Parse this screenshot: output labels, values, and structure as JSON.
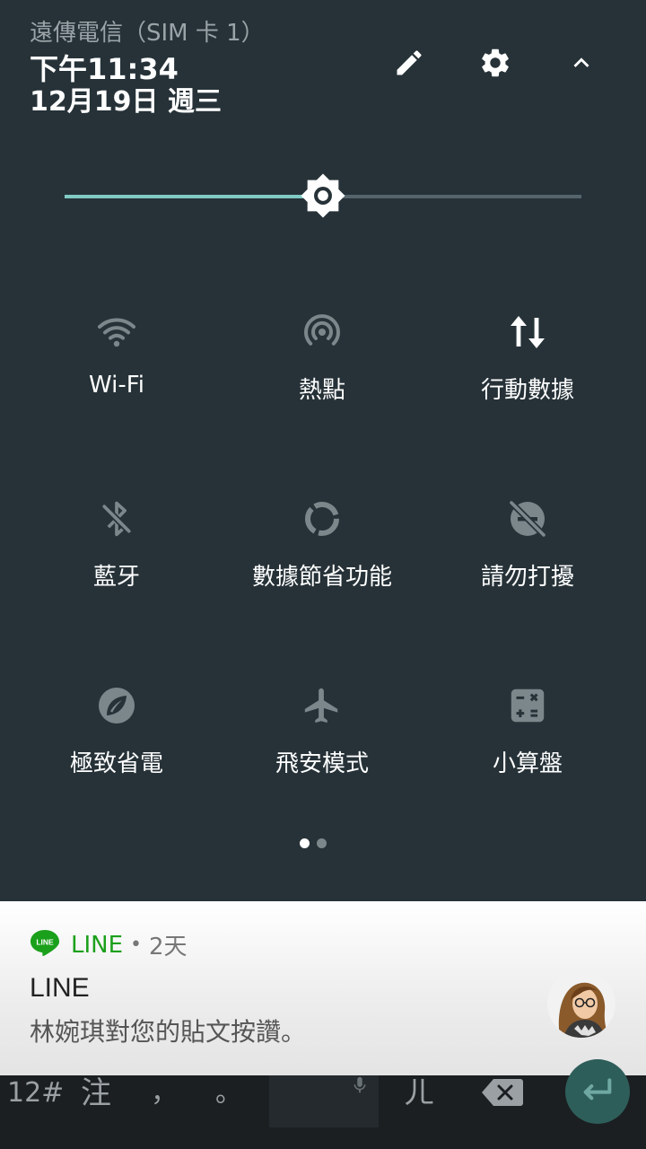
{
  "status": {
    "carrier": "遠傳電信（SIM 卡 1）",
    "time": "下午11:34",
    "date": "12月19日 週三"
  },
  "header_icons": [
    "edit-icon",
    "settings-icon",
    "collapse-icon"
  ],
  "brightness": {
    "level": 0.5,
    "fill_color": "#80cbc4"
  },
  "tiles": [
    {
      "label": "Wi-Fi",
      "icon": "wifi-icon",
      "active": false
    },
    {
      "label": "熱點",
      "icon": "hotspot-icon",
      "active": false
    },
    {
      "label": "行動數據",
      "icon": "mobile-data-icon",
      "active": true
    },
    {
      "label": "藍牙",
      "icon": "bluetooth-off-icon",
      "active": false
    },
    {
      "label": "數據節省功能",
      "icon": "data-saver-icon",
      "active": false
    },
    {
      "label": "請勿打擾",
      "icon": "do-not-disturb-icon",
      "active": false
    },
    {
      "label": "極致省電",
      "icon": "battery-saver-icon",
      "active": false
    },
    {
      "label": "飛安模式",
      "icon": "airplane-icon",
      "active": false
    },
    {
      "label": "小算盤",
      "icon": "calculator-icon",
      "active": false
    }
  ],
  "pager": {
    "current": 1,
    "total": 2
  },
  "notification": {
    "app": "LINE",
    "separator": "•",
    "time": "2天",
    "title": "LINE",
    "text": "林婉琪對您的貼文按讚。",
    "app_color": "#1ba01b",
    "logo_text": "LINE"
  },
  "keyboard": {
    "keys": [
      "12#",
      "注",
      "，",
      "。",
      "ㄦ"
    ]
  },
  "colors": {
    "panel_bg": "#263238",
    "icon_inactive": "#7c878c",
    "icon_active": "#ffffff"
  }
}
